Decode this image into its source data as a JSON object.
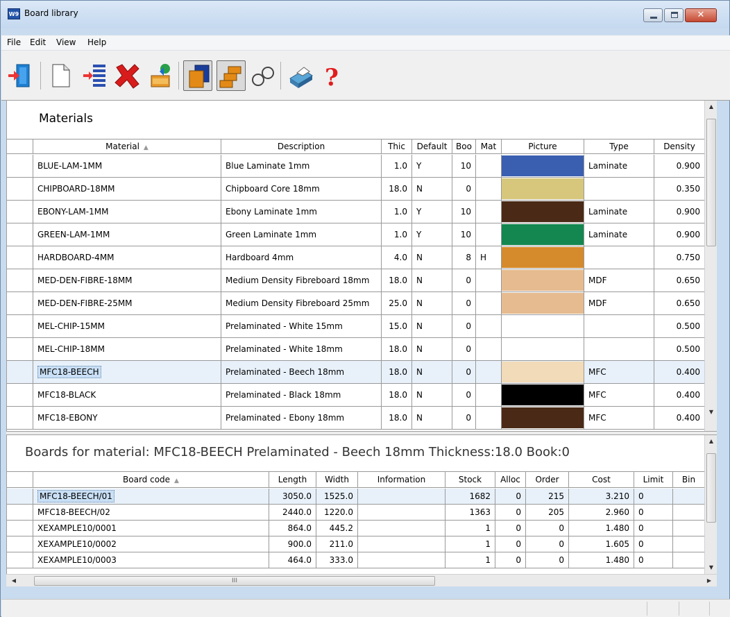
{
  "window": {
    "title": "Board library",
    "app_icon": "W9"
  },
  "menu": [
    "File",
    "Edit",
    "View",
    "Help"
  ],
  "toolbar": {
    "icons": [
      "exit-icon",
      "new-icon",
      "list-icon",
      "delete-icon",
      "import-icon",
      "materials-view-icon",
      "boards-view-icon",
      "search-icon",
      "print-icon",
      "help-icon"
    ],
    "pressed": [
      "materials-view-icon",
      "boards-view-icon"
    ]
  },
  "materials": {
    "title": "Materials",
    "columns": [
      "Material",
      "Description",
      "Thic",
      "Default",
      "Boo",
      "Mat",
      "Picture",
      "Type",
      "Density"
    ],
    "rows": [
      {
        "material": "BLUE-LAM-1MM",
        "description": "Blue Laminate 1mm",
        "thick": "1.0",
        "default": "Y",
        "book": "10",
        "mat": "",
        "color": "#3a5fb0",
        "type": "Laminate",
        "density": "0.900"
      },
      {
        "material": "CHIPBOARD-18MM",
        "description": "Chipboard Core 18mm",
        "thick": "18.0",
        "default": "N",
        "book": "0",
        "mat": "",
        "color": "#d6c77c",
        "type": "",
        "density": "0.350"
      },
      {
        "material": "EBONY-LAM-1MM",
        "description": "Ebony Laminate 1mm",
        "thick": "1.0",
        "default": "Y",
        "book": "10",
        "mat": "",
        "color": "#4a2a16",
        "type": "Laminate",
        "density": "0.900"
      },
      {
        "material": "GREEN-LAM-1MM",
        "description": "Green Laminate 1mm",
        "thick": "1.0",
        "default": "Y",
        "book": "10",
        "mat": "",
        "color": "#13874f",
        "type": "Laminate",
        "density": "0.900"
      },
      {
        "material": "HARDBOARD-4MM",
        "description": "Hardboard 4mm",
        "thick": "4.0",
        "default": "N",
        "book": "8",
        "mat": "H",
        "color": "#d58a2c",
        "type": "",
        "density": "0.750"
      },
      {
        "material": "MED-DEN-FIBRE-18MM",
        "description": "Medium Density Fibreboard 18mm",
        "thick": "18.0",
        "default": "N",
        "book": "0",
        "mat": "",
        "color": "#e5bb8f",
        "type": "MDF",
        "density": "0.650"
      },
      {
        "material": "MED-DEN-FIBRE-25MM",
        "description": "Medium Density Fibreboard 25mm",
        "thick": "25.0",
        "default": "N",
        "book": "0",
        "mat": "",
        "color": "#e5bb8f",
        "type": "MDF",
        "density": "0.650"
      },
      {
        "material": "MEL-CHIP-15MM",
        "description": "Prelaminated - White 15mm",
        "thick": "15.0",
        "default": "N",
        "book": "0",
        "mat": "",
        "color": "#ffffff",
        "type": "",
        "density": "0.500"
      },
      {
        "material": "MEL-CHIP-18MM",
        "description": "Prelaminated - White 18mm",
        "thick": "18.0",
        "default": "N",
        "book": "0",
        "mat": "",
        "color": "#ffffff",
        "type": "",
        "density": "0.500"
      },
      {
        "material": "MFC18-BEECH",
        "description": "Prelaminated - Beech 18mm",
        "thick": "18.0",
        "default": "N",
        "book": "0",
        "mat": "",
        "color": "#f2dbb8",
        "type": "MFC",
        "density": "0.400",
        "selected": true
      },
      {
        "material": "MFC18-BLACK",
        "description": "Prelaminated - Black 18mm",
        "thick": "18.0",
        "default": "N",
        "book": "0",
        "mat": "",
        "color": "#000000",
        "type": "MFC",
        "density": "0.400"
      },
      {
        "material": "MFC18-EBONY",
        "description": "Prelaminated - Ebony 18mm",
        "thick": "18.0",
        "default": "N",
        "book": "0",
        "mat": "",
        "color": "#4a2a16",
        "type": "MFC",
        "density": "0.400"
      }
    ]
  },
  "boards": {
    "title": "Boards for material: MFC18-BEECH Prelaminated - Beech 18mm Thickness:18.0 Book:0",
    "columns": [
      "Board code",
      "Length",
      "Width",
      "Information",
      "Stock",
      "Alloc",
      "Order",
      "Cost",
      "Limit",
      "Bin"
    ],
    "rows": [
      {
        "code": "MFC18-BEECH/01",
        "length": "3050.0",
        "width": "1525.0",
        "info": "",
        "stock": "1682",
        "alloc": "0",
        "order": "215",
        "cost": "3.210",
        "limit": "0",
        "bin": "",
        "selected": true
      },
      {
        "code": "MFC18-BEECH/02",
        "length": "2440.0",
        "width": "1220.0",
        "info": "",
        "stock": "1363",
        "alloc": "0",
        "order": "205",
        "cost": "2.960",
        "limit": "0",
        "bin": ""
      },
      {
        "code": "XEXAMPLE10/0001",
        "length": "864.0",
        "width": "445.2",
        "info": "",
        "stock": "1",
        "alloc": "0",
        "order": "0",
        "cost": "1.480",
        "limit": "0",
        "bin": ""
      },
      {
        "code": "XEXAMPLE10/0002",
        "length": "900.0",
        "width": "211.0",
        "info": "",
        "stock": "1",
        "alloc": "0",
        "order": "0",
        "cost": "1.605",
        "limit": "0",
        "bin": ""
      },
      {
        "code": "XEXAMPLE10/0003",
        "length": "464.0",
        "width": "333.0",
        "info": "",
        "stock": "1",
        "alloc": "0",
        "order": "0",
        "cost": "1.480",
        "limit": "0",
        "bin": ""
      }
    ]
  },
  "scrollbar_grip": "III"
}
